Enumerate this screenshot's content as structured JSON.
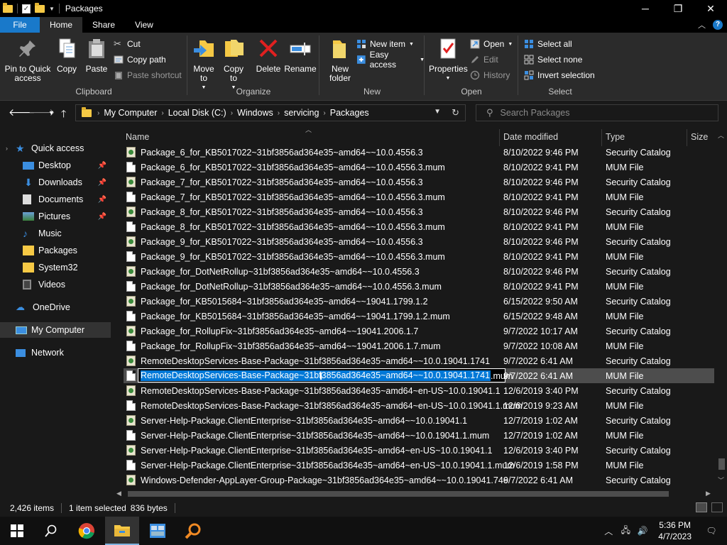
{
  "window": {
    "title": "Packages",
    "controls": {
      "minimize": "─",
      "maximize": "❐",
      "close": "✕"
    }
  },
  "ribbon_tabs": [
    "File",
    "Home",
    "Share",
    "View"
  ],
  "ribbon": {
    "clipboard": {
      "label": "Clipboard",
      "pin": "Pin to Quick access",
      "copy": "Copy",
      "paste": "Paste",
      "cut": "Cut",
      "copy_path": "Copy path",
      "paste_shortcut": "Paste shortcut"
    },
    "organize": {
      "label": "Organize",
      "move_to": "Move to",
      "copy_to": "Copy to",
      "delete": "Delete",
      "rename": "Rename"
    },
    "new": {
      "label": "New",
      "new_folder": "New folder",
      "new_item": "New item",
      "easy_access": "Easy access"
    },
    "open": {
      "label": "Open",
      "properties": "Properties",
      "open": "Open",
      "edit": "Edit",
      "history": "History"
    },
    "select": {
      "label": "Select",
      "select_all": "Select all",
      "select_none": "Select none",
      "invert": "Invert selection"
    }
  },
  "address": {
    "crumbs": [
      "My Computer",
      "Local Disk (C:)",
      "Windows",
      "servicing",
      "Packages"
    ],
    "search_placeholder": "Search Packages"
  },
  "nav": [
    {
      "label": "Quick access",
      "icon": "star-icon",
      "pinned": false
    },
    {
      "label": "Desktop",
      "icon": "desktop-icon",
      "pinned": true
    },
    {
      "label": "Downloads",
      "icon": "download-icon",
      "pinned": true
    },
    {
      "label": "Documents",
      "icon": "documents-icon",
      "pinned": true
    },
    {
      "label": "Pictures",
      "icon": "pictures-icon",
      "pinned": true
    },
    {
      "label": "Music",
      "icon": "music-icon",
      "pinned": false
    },
    {
      "label": "Packages",
      "icon": "folder-icon",
      "pinned": false
    },
    {
      "label": "System32",
      "icon": "folder-icon",
      "pinned": false
    },
    {
      "label": "Videos",
      "icon": "videos-icon",
      "pinned": false
    },
    {
      "label": "OneDrive",
      "icon": "cloud-icon",
      "pinned": false
    },
    {
      "label": "My Computer",
      "icon": "computer-icon",
      "pinned": false
    },
    {
      "label": "Network",
      "icon": "network-icon",
      "pinned": false
    }
  ],
  "columns": [
    "Name",
    "Date modified",
    "Type",
    "Size"
  ],
  "files": [
    {
      "name": "Package_6_for_KB5017022~31bf3856ad364e35~amd64~~10.0.4556.3",
      "date": "8/10/2022 9:46 PM",
      "type": "Security Catalog"
    },
    {
      "name": "Package_6_for_KB5017022~31bf3856ad364e35~amd64~~10.0.4556.3.mum",
      "date": "8/10/2022 9:41 PM",
      "type": "MUM File"
    },
    {
      "name": "Package_7_for_KB5017022~31bf3856ad364e35~amd64~~10.0.4556.3",
      "date": "8/10/2022 9:46 PM",
      "type": "Security Catalog"
    },
    {
      "name": "Package_7_for_KB5017022~31bf3856ad364e35~amd64~~10.0.4556.3.mum",
      "date": "8/10/2022 9:41 PM",
      "type": "MUM File"
    },
    {
      "name": "Package_8_for_KB5017022~31bf3856ad364e35~amd64~~10.0.4556.3",
      "date": "8/10/2022 9:46 PM",
      "type": "Security Catalog"
    },
    {
      "name": "Package_8_for_KB5017022~31bf3856ad364e35~amd64~~10.0.4556.3.mum",
      "date": "8/10/2022 9:41 PM",
      "type": "MUM File"
    },
    {
      "name": "Package_9_for_KB5017022~31bf3856ad364e35~amd64~~10.0.4556.3",
      "date": "8/10/2022 9:46 PM",
      "type": "Security Catalog"
    },
    {
      "name": "Package_9_for_KB5017022~31bf3856ad364e35~amd64~~10.0.4556.3.mum",
      "date": "8/10/2022 9:41 PM",
      "type": "MUM File"
    },
    {
      "name": "Package_for_DotNetRollup~31bf3856ad364e35~amd64~~10.0.4556.3",
      "date": "8/10/2022 9:46 PM",
      "type": "Security Catalog"
    },
    {
      "name": "Package_for_DotNetRollup~31bf3856ad364e35~amd64~~10.0.4556.3.mum",
      "date": "8/10/2022 9:41 PM",
      "type": "MUM File"
    },
    {
      "name": "Package_for_KB5015684~31bf3856ad364e35~amd64~~19041.1799.1.2",
      "date": "6/15/2022 9:50 AM",
      "type": "Security Catalog"
    },
    {
      "name": "Package_for_KB5015684~31bf3856ad364e35~amd64~~19041.1799.1.2.mum",
      "date": "6/15/2022 9:48 AM",
      "type": "MUM File"
    },
    {
      "name": "Package_for_RollupFix~31bf3856ad364e35~amd64~~19041.2006.1.7",
      "date": "9/7/2022 10:17 AM",
      "type": "Security Catalog"
    },
    {
      "name": "Package_for_RollupFix~31bf3856ad364e35~amd64~~19041.2006.1.7.mum",
      "date": "9/7/2022 10:08 AM",
      "type": "MUM File"
    },
    {
      "name": "RemoteDesktopServices-Base-Package~31bf3856ad364e35~amd64~~10.0.19041.1741",
      "date": "9/7/2022 6:41 AM",
      "type": "Security Catalog"
    },
    {
      "name": "RemoteDesktopServices-Base-Package~31bf3856ad364e35~amd64~~10.0.19041.1741.mum",
      "date": "9/7/2022 6:41 AM",
      "type": "MUM File",
      "renaming": true,
      "sel_part": "RemoteDesktopServices-Base-Package~31bf3856ad364e35~amd64~~10.0.19041.1741",
      "rest_part": ".mum"
    },
    {
      "name": "RemoteDesktopServices-Base-Package~31bf3856ad364e35~amd64~en-US~10.0.19041.1",
      "date": "12/6/2019 3:40 PM",
      "type": "Security Catalog"
    },
    {
      "name": "RemoteDesktopServices-Base-Package~31bf3856ad364e35~amd64~en-US~10.0.19041.1.mum",
      "date": "12/6/2019 9:23 AM",
      "type": "MUM File"
    },
    {
      "name": "Server-Help-Package.ClientEnterprise~31bf3856ad364e35~amd64~~10.0.19041.1",
      "date": "12/7/2019 1:02 AM",
      "type": "Security Catalog"
    },
    {
      "name": "Server-Help-Package.ClientEnterprise~31bf3856ad364e35~amd64~~10.0.19041.1.mum",
      "date": "12/7/2019 1:02 AM",
      "type": "MUM File"
    },
    {
      "name": "Server-Help-Package.ClientEnterprise~31bf3856ad364e35~amd64~en-US~10.0.19041.1",
      "date": "12/6/2019 3:40 PM",
      "type": "Security Catalog"
    },
    {
      "name": "Server-Help-Package.ClientEnterprise~31bf3856ad364e35~amd64~en-US~10.0.19041.1.mum",
      "date": "12/6/2019 1:58 PM",
      "type": "MUM File"
    },
    {
      "name": "Windows-Defender-AppLayer-Group-Package~31bf3856ad364e35~amd64~~10.0.19041.746",
      "date": "9/7/2022 6:41 AM",
      "type": "Security Catalog"
    }
  ],
  "status": {
    "items": "2,426 items",
    "selected": "1 item selected",
    "size": "836 bytes"
  },
  "clock": {
    "time": "5:36 PM",
    "date": "4/7/2023"
  },
  "colors": {
    "accent": "#1979ca",
    "selection": "#0078d7",
    "folder": "#f6c945"
  }
}
